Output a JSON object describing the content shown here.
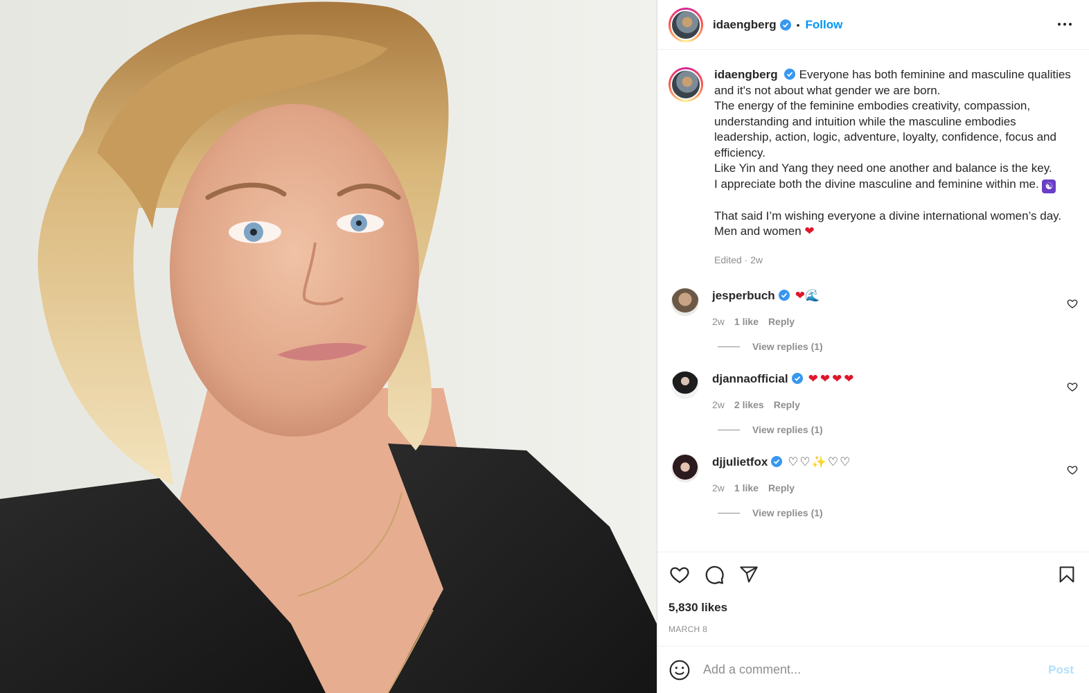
{
  "post": {
    "author": "idaengberg",
    "follow_label": "Follow",
    "dot": "•",
    "caption_lines": [
      "Everyone has both feminine and masculine qualities",
      "and it's not about what gender we are born.",
      "The energy of the feminine embodies creativity, compassion,",
      "understanding and intuition while the masculine embodies",
      "leadership, action, logic, adventure, loyalty, confidence, focus and",
      "efficiency.",
      "Like Yin and Yang they need one another and balance is the key.",
      "I appreciate both the divine masculine and feminine within me.",
      "That said I’m wishing everyone a divine international women’s day.",
      "Men and women"
    ],
    "caption_emoji_1": "☯",
    "caption_emoji_2": "❤",
    "edited": "Edited · 2w",
    "likes_total": "5,830 likes",
    "date": "MARCH 8"
  },
  "comments": [
    {
      "user": "jesperbuch",
      "text": "❤🌊",
      "time": "2w",
      "likes": "1 like",
      "reply": "Reply",
      "view_replies": "View replies (1)"
    },
    {
      "user": "djannaofficial",
      "text": "❤❤❤❤",
      "time": "2w",
      "likes": "2 likes",
      "reply": "Reply",
      "view_replies": "View replies (1)"
    },
    {
      "user": "djjulietfox",
      "text": "♡♡✨♡♡",
      "time": "2w",
      "likes": "1 like",
      "reply": "Reply",
      "view_replies": "View replies (1)"
    }
  ],
  "add_comment": {
    "placeholder": "Add a comment...",
    "post_label": "Post"
  },
  "colors": {
    "accent": "#0095f6",
    "post_disabled": "#b2dffc",
    "verified": "#3897f0",
    "heart": "#e0162b"
  },
  "icons": [
    "verified-icon",
    "more-icon",
    "heart-icon",
    "comment-icon",
    "share-icon",
    "bookmark-icon",
    "smile-icon"
  ]
}
